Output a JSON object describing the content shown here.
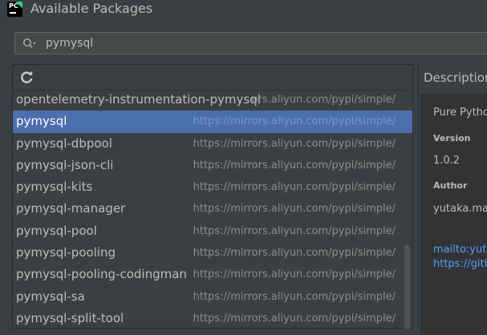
{
  "window": {
    "title": "Available Packages",
    "app_icon_text": "PC"
  },
  "search": {
    "value": "pymysql"
  },
  "packages": [
    {
      "name": "opentelemetry-instrumentation-pymysql",
      "repo": "ors.aliyun.com/pypi/simple/"
    },
    {
      "name": "pymysql",
      "repo": "https://mirrors.aliyun.com/pypi/simple/"
    },
    {
      "name": "pymysql-dbpool",
      "repo": "https://mirrors.aliyun.com/pypi/simple/"
    },
    {
      "name": "pymysql-json-cli",
      "repo": "https://mirrors.aliyun.com/pypi/simple/"
    },
    {
      "name": "pymysql-kits",
      "repo": "https://mirrors.aliyun.com/pypi/simple/"
    },
    {
      "name": "pymysql-manager",
      "repo": "https://mirrors.aliyun.com/pypi/simple/"
    },
    {
      "name": "pymysql-pool",
      "repo": "https://mirrors.aliyun.com/pypi/simple/"
    },
    {
      "name": "pymysql-pooling",
      "repo": "https://mirrors.aliyun.com/pypi/simple/"
    },
    {
      "name": "pymysql-pooling-codingman",
      "repo": "https://mirrors.aliyun.com/pypi/simple/"
    },
    {
      "name": "pymysql-sa",
      "repo": "https://mirrors.aliyun.com/pypi/simple/"
    },
    {
      "name": "pymysql-split-tool",
      "repo": "https://mirrors.aliyun.com/pypi/simple/"
    }
  ],
  "selected_package": "pymysql",
  "description": {
    "header": "Description",
    "summary": "Pure Pytho",
    "version_label": "Version",
    "version": "1.0.2",
    "author_label": "Author",
    "author": "yutaka.ma",
    "link1": "mailto:yuta",
    "link2": "https://gith"
  },
  "colors": {
    "background": "#3c3f41",
    "selection": "#4b6eaf",
    "link": "#589df6"
  }
}
